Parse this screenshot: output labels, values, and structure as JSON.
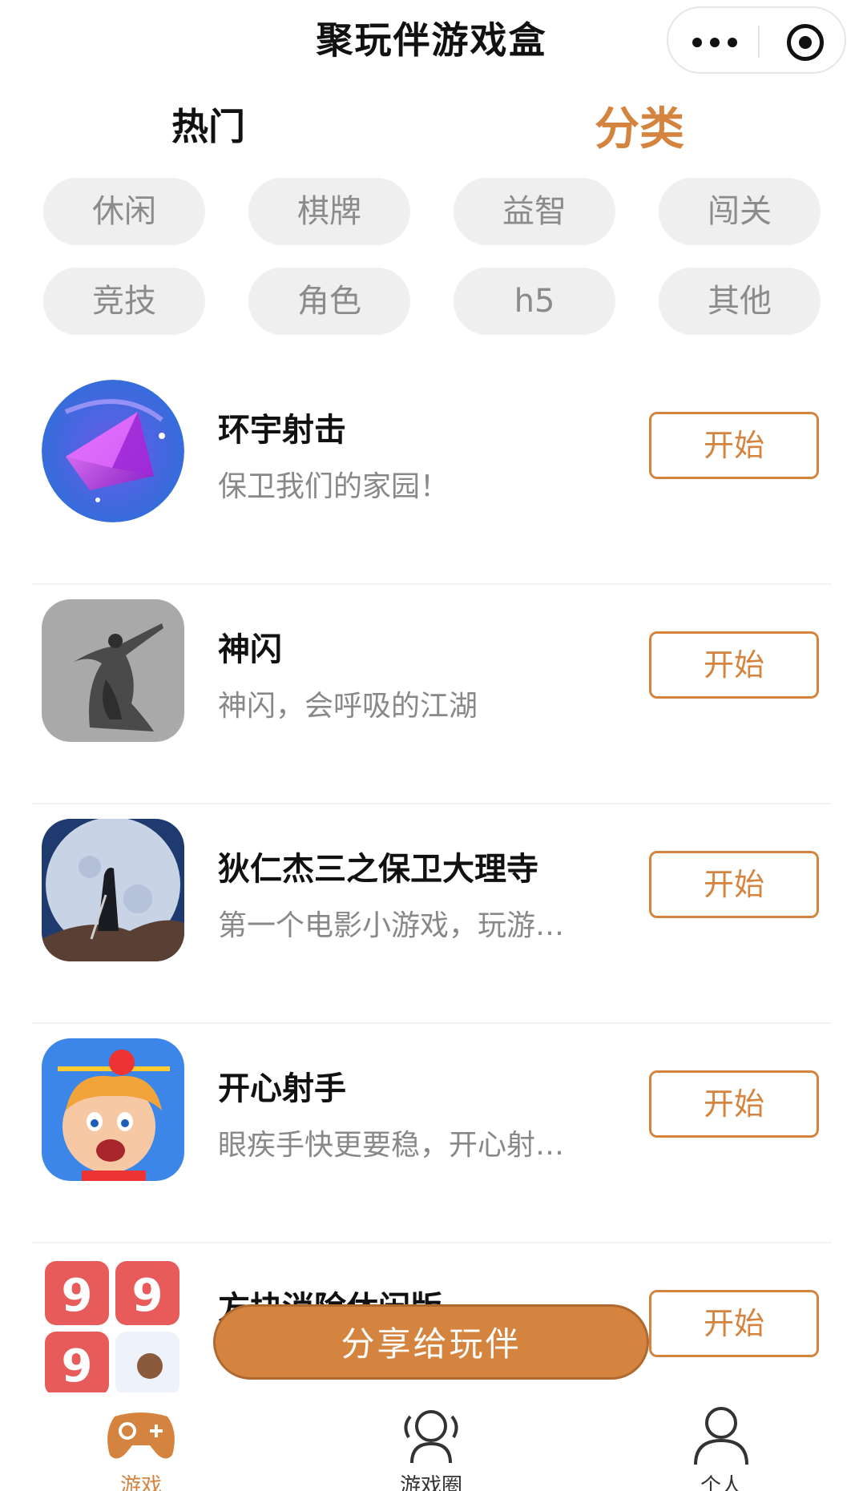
{
  "header": {
    "title": "聚玩伴游戏盒"
  },
  "tabs": {
    "hot": "热门",
    "category": "分类"
  },
  "categories": [
    "休闲",
    "棋牌",
    "益智",
    "闯关",
    "竞技",
    "角色",
    "h5",
    "其他"
  ],
  "games": [
    {
      "name": "环宇射击",
      "desc": "保卫我们的家园！",
      "start": "开始",
      "icon": "crystal-game-icon"
    },
    {
      "name": "神闪",
      "desc": "神闪，会呼吸的江湖",
      "start": "开始",
      "icon": "swordsman-game-icon"
    },
    {
      "name": "狄仁杰三之保卫大理寺",
      "desc": "第一个电影小游戏，玩游…",
      "start": "开始",
      "icon": "moon-warrior-game-icon"
    },
    {
      "name": "开心射手",
      "desc": "眼疾手快更要稳，开心射…",
      "start": "开始",
      "icon": "archer-boy-game-icon"
    },
    {
      "name": "方块消除休闲版",
      "desc": "",
      "start": "开始",
      "icon": "number-blocks-game-icon"
    }
  ],
  "share_button": "分享给玩伴",
  "tabbar": [
    {
      "label": "游戏",
      "icon": "gamepad-icon",
      "active": true
    },
    {
      "label": "游戏圈",
      "icon": "group-icon",
      "active": false
    },
    {
      "label": "个人",
      "icon": "person-icon",
      "active": false
    }
  ],
  "colors": {
    "accent": "#d4843f",
    "chip_bg": "#efefef",
    "chip_text": "#8b8b8b"
  }
}
